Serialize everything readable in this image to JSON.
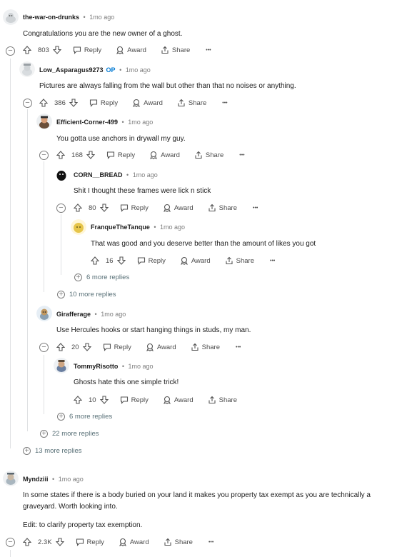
{
  "comments": {
    "c1": {
      "author": "the-war-on-drunks",
      "time": "1mo ago",
      "body": "Congratulations you are the new owner of a ghost.",
      "score": "803"
    },
    "c2": {
      "author": "Low_Asparagus9273",
      "op": "OP",
      "time": "1mo ago",
      "body": "Pictures are always falling from the wall but other than that no noises or anything.",
      "score": "386"
    },
    "c3": {
      "author": "Efficient-Corner-499",
      "time": "1mo ago",
      "body": "You gotta use anchors in drywall my guy.",
      "score": "168"
    },
    "c4": {
      "author": "CORN__BREAD",
      "time": "1mo ago",
      "body": "Shit I thought these frames were lick n stick",
      "score": "80"
    },
    "c5": {
      "author": "FranqueTheTanque",
      "time": "1mo ago",
      "body": "That was good and you deserve better than the amount of likes you got",
      "score": "16"
    },
    "c6": {
      "author": "Girafferage",
      "time": "1mo ago",
      "body": "Use Hercules hooks or start hanging things in studs, my man.",
      "score": "20"
    },
    "c7": {
      "author": "TommyRisotto",
      "time": "1mo ago",
      "body": "Ghosts hate this one simple trick!",
      "score": "10"
    },
    "c8": {
      "author": "Myndziii",
      "time": "1mo ago",
      "body1": "In some states if there is a body buried on your land it makes you property tax exempt as you are technically a graveyard. Worth looking into.",
      "body2": "Edit: to clarify property tax exemption.",
      "score": "2.3K"
    }
  },
  "more": {
    "m1": "6 more replies",
    "m2": "10 more replies",
    "m3": "6 more replies",
    "m4": "22 more replies",
    "m5": "13 more replies"
  },
  "actions": {
    "reply": "Reply",
    "award": "Award",
    "share": "Share",
    "more": "•••",
    "sep": "•"
  },
  "icons": [
    "upvote-icon",
    "downvote-icon",
    "reply-icon",
    "award-icon",
    "share-icon",
    "collapse-icon",
    "expand-icon"
  ],
  "colors": {
    "text": "#1c1c1c",
    "meta": "#7c7c7c",
    "op": "#0079d3",
    "thread": "#dfe1e3"
  }
}
